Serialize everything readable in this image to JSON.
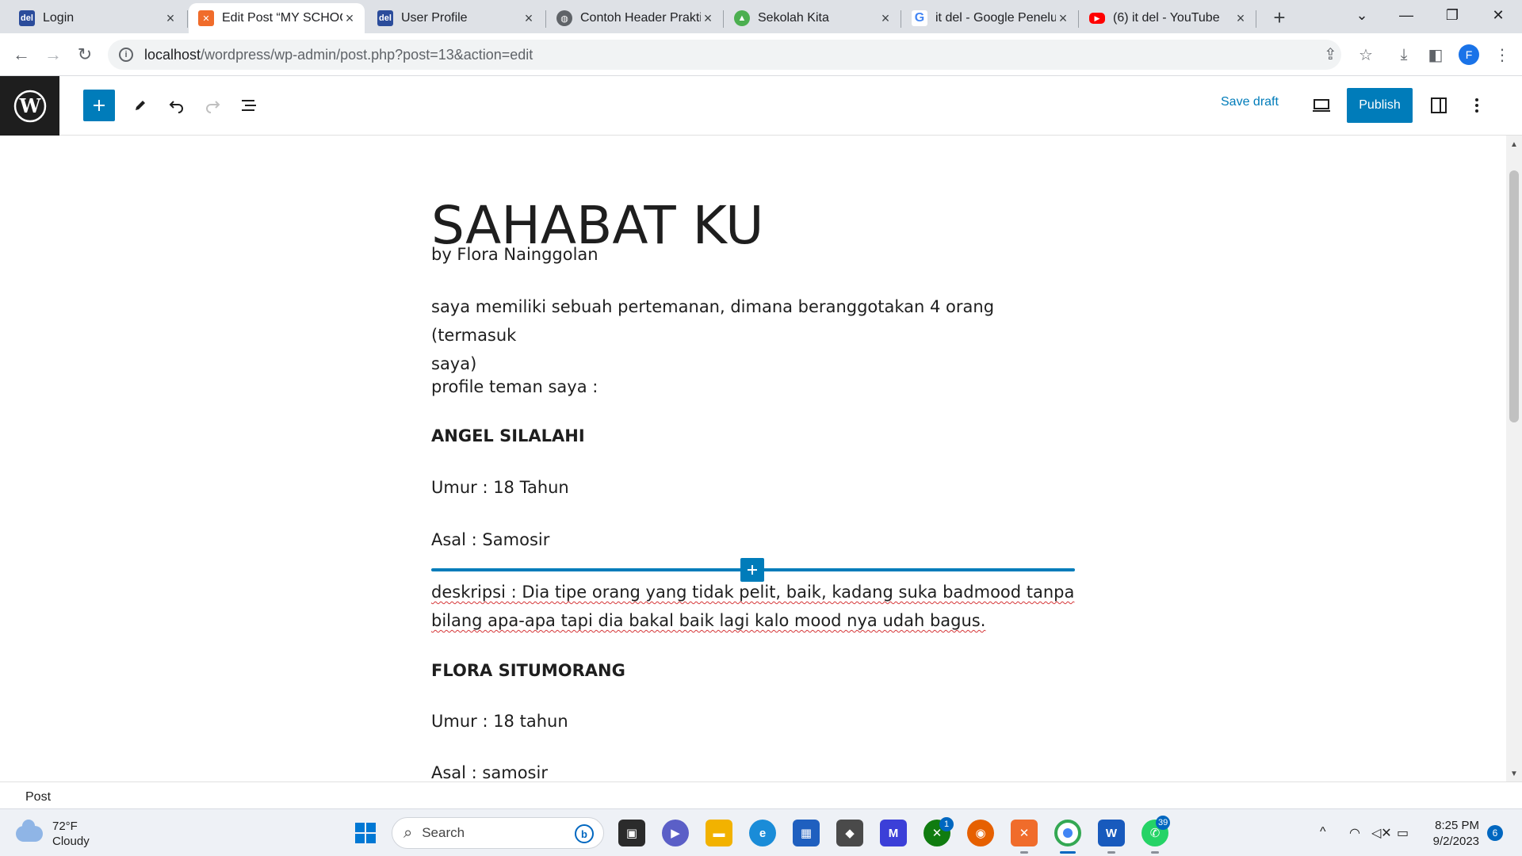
{
  "browser": {
    "tabs": [
      {
        "title": "Login",
        "favicon": "del-icon"
      },
      {
        "title": "Edit Post “MY SCHOOL”",
        "favicon": "xampp-icon"
      },
      {
        "title": "User Profile",
        "favicon": "del-icon"
      },
      {
        "title": "Contoh Header Praktis",
        "favicon": "globe-icon"
      },
      {
        "title": "Sekolah Kita",
        "favicon": "school-icon"
      },
      {
        "title": "it del - Google Penelusuran",
        "favicon": "google-icon"
      },
      {
        "title": "(6) it del - YouTube",
        "favicon": "youtube-icon"
      }
    ],
    "address": {
      "host": "localhost",
      "path": "/wordpress/wp-admin/post.php?post=13&action=edit"
    },
    "profile_initial": "F"
  },
  "wp_header": {
    "save_draft_label": "Save draft",
    "publish_label": "Publish"
  },
  "post": {
    "title": "SAHABAT KU",
    "blocks": [
      {
        "text": "by Flora Nainggolan"
      },
      {
        "text_line1": "saya memiliki sebuah pertemanan, dimana beranggotakan 4 orang (termasuk",
        "text_line2": "saya)"
      },
      {
        "text": "profile teman saya :"
      },
      {
        "text": "ANGEL SILALAHI"
      },
      {
        "text": "Umur : 18 Tahun"
      },
      {
        "text": "Asal : Samosir"
      },
      {
        "text_line1": "deskripsi : Dia tipe orang yang tidak pelit, baik, kadang suka badmood tanpa",
        "text_line2": "bilang apa-apa tapi dia bakal baik lagi kalo mood nya udah bagus."
      },
      {
        "text": "FLORA SITUMORANG"
      },
      {
        "text": "Umur : 18 tahun"
      },
      {
        "text": "Asal : samosir"
      }
    ]
  },
  "statusbar": {
    "label": "Post"
  },
  "taskbar": {
    "weather_temp": "72°F",
    "weather_desc": "Cloudy",
    "search_placeholder": "Search",
    "xbox_badge": "1",
    "whatsapp_badge": "39",
    "time": "8:25 PM",
    "date": "9/2/2023",
    "notifications": "6"
  },
  "colors": {
    "wp_blue": "#007cba",
    "spellcheck": "#d63638"
  }
}
